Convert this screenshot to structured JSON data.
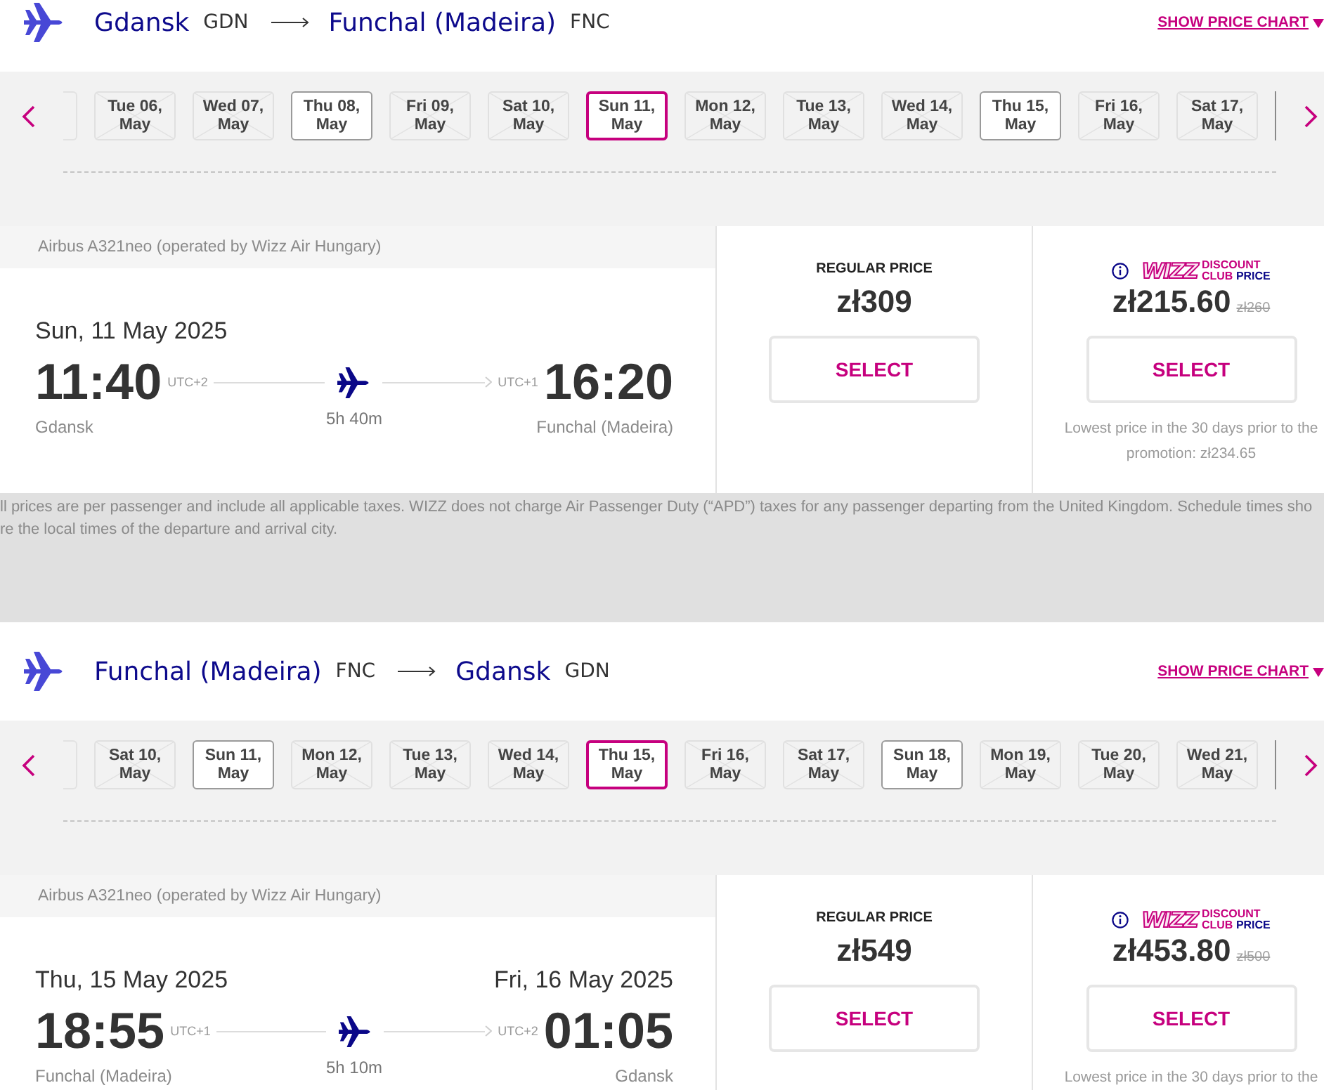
{
  "outbound": {
    "header": {
      "from_city": "Gdansk",
      "from_code": "GDN",
      "to_city": "Funchal (Madeira)",
      "to_code": "FNC",
      "chart_link": "SHOW PRICE CHART"
    },
    "dates": [
      {
        "day": "Tue 06,",
        "month": "May",
        "available": false,
        "selected": false
      },
      {
        "day": "Wed 07,",
        "month": "May",
        "available": false,
        "selected": false
      },
      {
        "day": "Thu 08,",
        "month": "May",
        "available": true,
        "selected": false
      },
      {
        "day": "Fri 09,",
        "month": "May",
        "available": false,
        "selected": false
      },
      {
        "day": "Sat 10,",
        "month": "May",
        "available": false,
        "selected": false
      },
      {
        "day": "Sun 11,",
        "month": "May",
        "available": true,
        "selected": true
      },
      {
        "day": "Mon 12,",
        "month": "May",
        "available": false,
        "selected": false
      },
      {
        "day": "Tue 13,",
        "month": "May",
        "available": false,
        "selected": false
      },
      {
        "day": "Wed 14,",
        "month": "May",
        "available": false,
        "selected": false
      },
      {
        "day": "Thu 15,",
        "month": "May",
        "available": true,
        "selected": false
      },
      {
        "day": "Fri 16,",
        "month": "May",
        "available": false,
        "selected": false
      },
      {
        "day": "Sat 17,",
        "month": "May",
        "available": false,
        "selected": false
      }
    ],
    "flight": {
      "aircraft": "Airbus A321neo (operated by Wizz Air Hungary)",
      "departure_date": "Sun, 11 May 2025",
      "departure": {
        "time": "11:40",
        "utc": "UTC+2",
        "city": "Gdansk"
      },
      "duration": "5h 40m",
      "arrival": {
        "time": "16:20",
        "utc": "UTC+1",
        "city": "Funchal (Madeira)"
      },
      "fares": [
        {
          "kind": "regular",
          "label": "REGULAR PRICE",
          "price": "zł309",
          "button": "SELECT"
        },
        {
          "kind": "club",
          "logo": {
            "brand": "WIZZ",
            "line_1": "DISCOUNT",
            "line_2_accent": "CLUB",
            "line_2": "PRICE"
          },
          "price": "zł215.60",
          "old_price": "zł260",
          "button": "SELECT",
          "note": "Lowest price in the 30 days prior to the promotion: zł234.65"
        }
      ]
    }
  },
  "disclaimer": [
    "ll prices are per passenger and include all applicable taxes. WIZZ does not charge Air Passenger Duty (“APD”) taxes for any passenger departing from the United Kingdom. Schedule times sho",
    "re the local times of the departure and arrival city."
  ],
  "inbound": {
    "header": {
      "from_city": "Funchal (Madeira)",
      "from_code": "FNC",
      "to_city": "Gdansk",
      "to_code": "GDN",
      "chart_link": "SHOW PRICE CHART"
    },
    "dates": [
      {
        "day": "Sat 10,",
        "month": "May",
        "available": false,
        "selected": false
      },
      {
        "day": "Sun 11,",
        "month": "May",
        "available": true,
        "selected": false
      },
      {
        "day": "Mon 12,",
        "month": "May",
        "available": false,
        "selected": false
      },
      {
        "day": "Tue 13,",
        "month": "May",
        "available": false,
        "selected": false
      },
      {
        "day": "Wed 14,",
        "month": "May",
        "available": false,
        "selected": false
      },
      {
        "day": "Thu 15,",
        "month": "May",
        "available": true,
        "selected": true
      },
      {
        "day": "Fri 16,",
        "month": "May",
        "available": false,
        "selected": false
      },
      {
        "day": "Sat 17,",
        "month": "May",
        "available": false,
        "selected": false
      },
      {
        "day": "Sun 18,",
        "month": "May",
        "available": true,
        "selected": false
      },
      {
        "day": "Mon 19,",
        "month": "May",
        "available": false,
        "selected": false
      },
      {
        "day": "Tue 20,",
        "month": "May",
        "available": false,
        "selected": false
      },
      {
        "day": "Wed 21,",
        "month": "May",
        "available": false,
        "selected": false
      }
    ],
    "flight": {
      "aircraft": "Airbus A321neo (operated by Wizz Air Hungary)",
      "departure_date": "Thu, 15 May 2025",
      "arrival_date": "Fri, 16 May 2025",
      "departure": {
        "time": "18:55",
        "utc": "UTC+1",
        "city": "Funchal (Madeira)"
      },
      "duration": "5h 10m",
      "arrival": {
        "time": "01:05",
        "utc": "UTC+2",
        "city": "Gdansk"
      },
      "fares": [
        {
          "kind": "regular",
          "label": "REGULAR PRICE",
          "price": "zł549",
          "button": "SELECT"
        },
        {
          "kind": "club",
          "logo": {
            "brand": "WIZZ",
            "line_1": "DISCOUNT",
            "line_2_accent": "CLUB",
            "line_2": "PRICE"
          },
          "price": "zł453.80",
          "old_price": "zł500",
          "button": "SELECT",
          "note": "Lowest price in the 30 days prior to the"
        }
      ]
    }
  }
}
